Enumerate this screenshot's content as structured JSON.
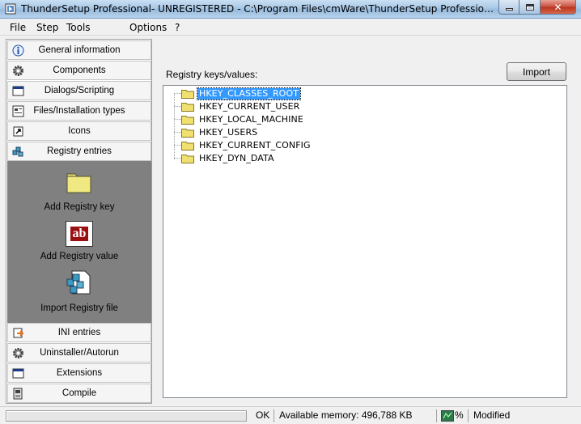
{
  "window": {
    "title": "ThunderSetup Professional- UNREGISTERED - C:\\Program Files\\cmWare\\ThunderSetup Professional\\default....",
    "minimize_icon": "minimize-icon",
    "maximize_icon": "maximize-icon",
    "close_glyph": "✕"
  },
  "menu": {
    "items": [
      {
        "label": "File"
      },
      {
        "label": "Step"
      },
      {
        "label": "Tools"
      },
      {
        "label": "Options"
      },
      {
        "label": "?"
      }
    ]
  },
  "sidebar": {
    "top_items": [
      {
        "label": "General information",
        "icon": "info-icon"
      },
      {
        "label": "Components",
        "icon": "gear-icon"
      },
      {
        "label": "Dialogs/Scripting",
        "icon": "dialog-icon"
      },
      {
        "label": "Files/Installation types",
        "icon": "files-icon"
      },
      {
        "label": "Icons",
        "icon": "shortcut-icon"
      },
      {
        "label": "Registry entries",
        "icon": "registry-icon"
      }
    ],
    "panel_items": [
      {
        "label": "Add Registry key",
        "icon": "folder-icon"
      },
      {
        "label": "Add Registry value",
        "icon": "string-value-icon",
        "icon_text": "ab"
      },
      {
        "label": "Import Registry file",
        "icon": "registry-file-icon"
      }
    ],
    "bottom_items": [
      {
        "label": "INI entries",
        "icon": "ini-icon"
      },
      {
        "label": "Uninstaller/Autorun",
        "icon": "uninstall-icon"
      },
      {
        "label": "Extensions",
        "icon": "extension-icon"
      },
      {
        "label": "Compile",
        "icon": "compile-icon"
      }
    ]
  },
  "main": {
    "section_label": "Registry keys/values:",
    "import_label": "Import",
    "tree": [
      {
        "label": "HKEY_CLASSES_ROOT",
        "selected": true
      },
      {
        "label": "HKEY_CURRENT_USER"
      },
      {
        "label": "HKEY_LOCAL_MACHINE"
      },
      {
        "label": "HKEY_USERS"
      },
      {
        "label": "HKEY_CURRENT_CONFIG"
      },
      {
        "label": "HKEY_DYN_DATA"
      }
    ]
  },
  "status": {
    "state": "OK",
    "memory": "Available memory: 496,788 KB",
    "percent": "%",
    "modified": "Modified"
  },
  "colors": {
    "panel_bg": "#808080",
    "selection": "#3399ff",
    "folder": "#f0e070"
  }
}
